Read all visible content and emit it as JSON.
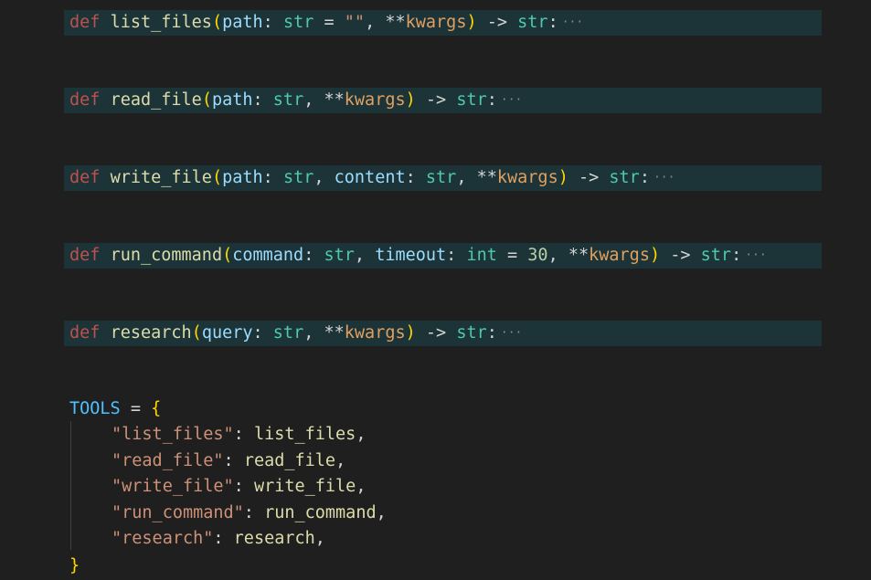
{
  "signatures": [
    {
      "kw": "def",
      "name": "list_files",
      "open": "(",
      "params": [
        {
          "name": "path",
          "sep": ": ",
          "type": "str",
          "default_op": " = ",
          "default": "\"\""
        },
        {
          "prefix": "**",
          "name": "kwargs"
        }
      ],
      "close": ")",
      "arrow": " -> ",
      "ret": "str",
      "colon": ":",
      "fold": "···"
    },
    {
      "kw": "def",
      "name": "read_file",
      "open": "(",
      "params": [
        {
          "name": "path",
          "sep": ": ",
          "type": "str"
        },
        {
          "prefix": "**",
          "name": "kwargs"
        }
      ],
      "close": ")",
      "arrow": " -> ",
      "ret": "str",
      "colon": ":",
      "fold": "···"
    },
    {
      "kw": "def",
      "name": "write_file",
      "open": "(",
      "params": [
        {
          "name": "path",
          "sep": ": ",
          "type": "str"
        },
        {
          "name": "content",
          "sep": ": ",
          "type": "str"
        },
        {
          "prefix": "**",
          "name": "kwargs"
        }
      ],
      "close": ")",
      "arrow": " -> ",
      "ret": "str",
      "colon": ":",
      "fold": "···"
    },
    {
      "kw": "def",
      "name": "run_command",
      "open": "(",
      "params": [
        {
          "name": "command",
          "sep": ": ",
          "type": "str"
        },
        {
          "name": "timeout",
          "sep": ": ",
          "type": "int",
          "default_op": " = ",
          "default_num": "30"
        },
        {
          "prefix": "**",
          "name": "kwargs"
        }
      ],
      "close": ")",
      "arrow": " -> ",
      "ret": "str",
      "colon": ":",
      "fold": "···"
    },
    {
      "kw": "def",
      "name": "research",
      "open": "(",
      "params": [
        {
          "name": "query",
          "sep": ": ",
          "type": "str"
        },
        {
          "prefix": "**",
          "name": "kwargs"
        }
      ],
      "close": ")",
      "arrow": " -> ",
      "ret": "str",
      "colon": ":",
      "fold": "···"
    }
  ],
  "tools": {
    "name": "TOOLS",
    "assign": " = ",
    "open": "{",
    "close": "}",
    "entries": [
      {
        "key": "\"list_files\"",
        "colon": ": ",
        "value": "list_files",
        "comma": ","
      },
      {
        "key": "\"read_file\"",
        "colon": ": ",
        "value": "read_file",
        "comma": ","
      },
      {
        "key": "\"write_file\"",
        "colon": ": ",
        "value": "write_file",
        "comma": ","
      },
      {
        "key": "\"run_command\"",
        "colon": ": ",
        "value": "run_command",
        "comma": ","
      },
      {
        "key": "\"research\"",
        "colon": ": ",
        "value": "research",
        "comma": ","
      }
    ]
  },
  "colors": {
    "background": "#1f1f1f",
    "folded_highlight": "#1c3337",
    "keyword": "#c0504d",
    "function": "#dcdcaa",
    "parameter": "#9cdcfe",
    "type": "#4ec9b0",
    "string": "#ce9178",
    "bracket": "#ffd700"
  }
}
